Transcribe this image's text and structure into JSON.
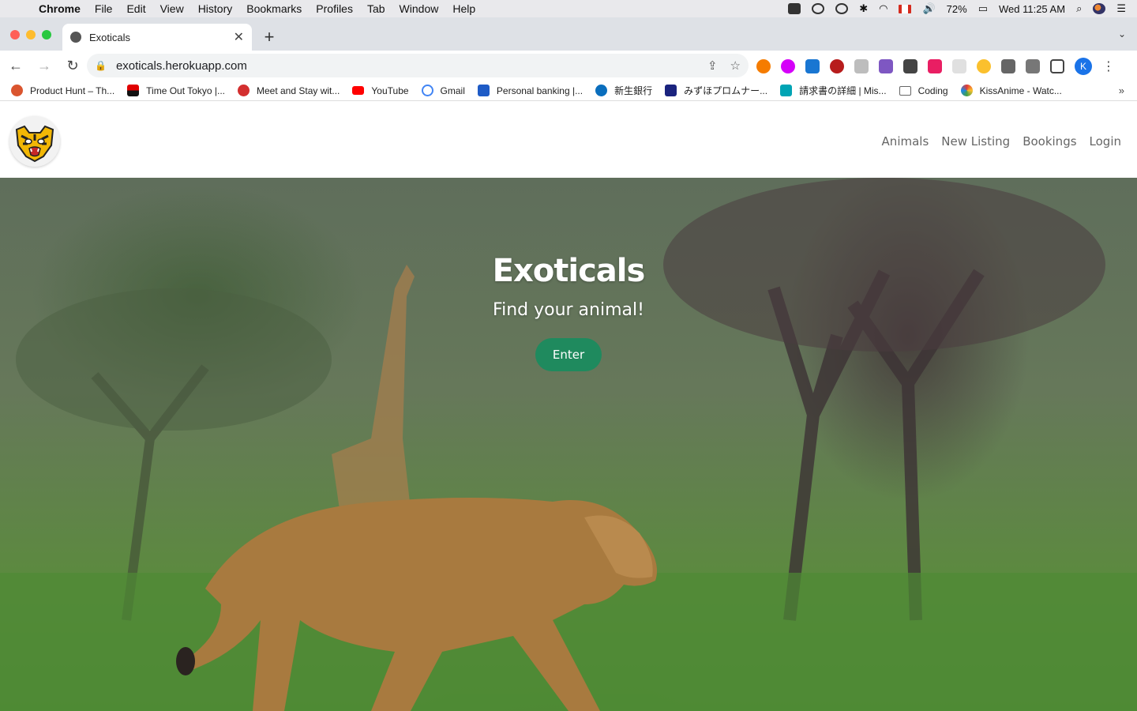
{
  "menubar": {
    "app_name": "Chrome",
    "items": [
      "File",
      "Edit",
      "View",
      "History",
      "Bookmarks",
      "Profiles",
      "Tab",
      "Window",
      "Help"
    ],
    "battery": "72%",
    "clock": "Wed 11:25 AM"
  },
  "browser": {
    "tab_title": "Exoticals",
    "new_tab": "+",
    "url": "exoticals.herokuapp.com",
    "profile_initial": "K"
  },
  "bookmarks": [
    {
      "label": "Product Hunt – Th...",
      "color": "#da552f"
    },
    {
      "label": "Time Out Tokyo |...",
      "color": "#e00000"
    },
    {
      "label": "Meet and Stay wit...",
      "color": "#d32f2f"
    },
    {
      "label": "YouTube",
      "color": "#ff0000"
    },
    {
      "label": "Gmail",
      "color": "#4285f4"
    },
    {
      "label": "Personal banking |...",
      "color": "#1e5bc6"
    },
    {
      "label": "新生銀行",
      "color": "#0a6ebd"
    },
    {
      "label": "みずほプロムナー...",
      "color": "#1a237e"
    },
    {
      "label": "請求書の詳細 | Mis...",
      "color": "#00a4b4"
    },
    {
      "label": "Coding",
      "color": "#666666"
    },
    {
      "label": "KissAnime - Watc...",
      "color": "#e53935"
    }
  ],
  "site": {
    "nav": {
      "animals": "Animals",
      "new_listing": "New Listing",
      "bookings": "Bookings",
      "login": "Login"
    },
    "hero": {
      "title": "Exoticals",
      "subtitle": "Find your animal!",
      "enter": "Enter"
    }
  },
  "colors": {
    "enter_button": "#1f8a5e",
    "nav_link": "#666666"
  }
}
